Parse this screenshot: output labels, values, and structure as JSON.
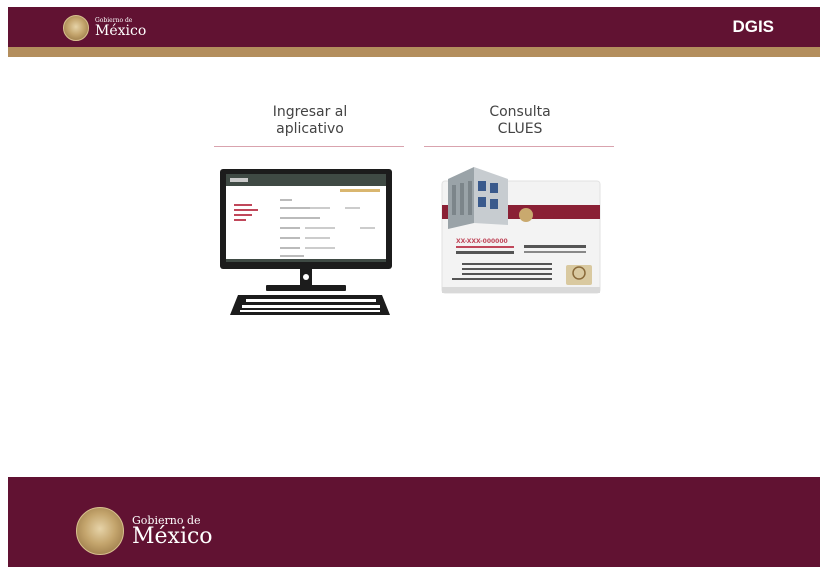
{
  "header": {
    "logo": {
      "line1": "Gobierno de",
      "line2": "México",
      "seal_icon": "mexico-coat-of-arms-icon"
    },
    "right_label": "DGIS"
  },
  "cards": [
    {
      "title_line1": "Ingresar al",
      "title_line2": "aplicativo",
      "illustration_icon": "desktop-computer-icon"
    },
    {
      "title_line1": "Consulta",
      "title_line2": "CLUES",
      "illustration_icon": "clues-building-card-icon"
    }
  ],
  "clues_card": {
    "brand": "SALUD",
    "code": "XX-XXX-000000"
  },
  "footer": {
    "logo": {
      "line1": "Gobierno de",
      "line2": "México",
      "seal_icon": "mexico-coat-of-arms-icon"
    }
  },
  "colors": {
    "primary": "#611232",
    "gold": "#b38e5d",
    "accent_line": "#d9a3ae"
  }
}
